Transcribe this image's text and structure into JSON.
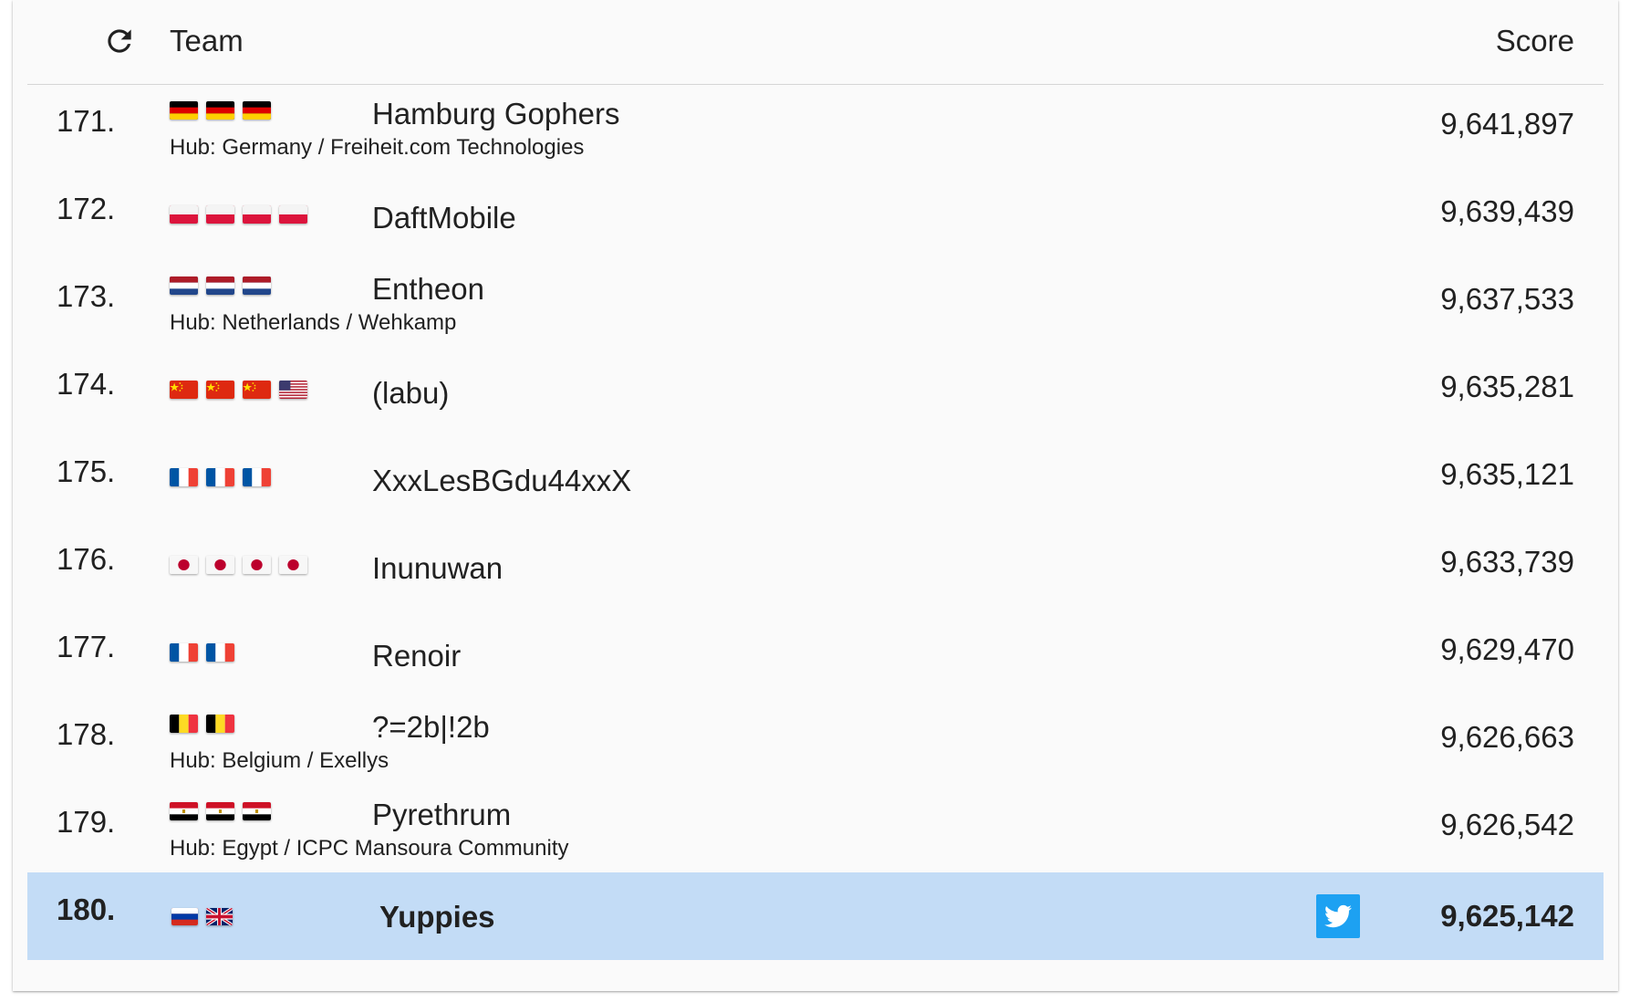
{
  "header": {
    "team_label": "Team",
    "score_label": "Score",
    "refresh_icon": "refresh-icon"
  },
  "rows": [
    {
      "rank": "171.",
      "flags": [
        "de",
        "de",
        "de"
      ],
      "name": "Hamburg Gophers",
      "hub": "Hub: Germany / Freiheit.com Technologies",
      "score": "9,641,897"
    },
    {
      "rank": "172.",
      "flags": [
        "pl",
        "pl",
        "pl",
        "pl"
      ],
      "name": "DaftMobile",
      "hub": "",
      "score": "9,639,439"
    },
    {
      "rank": "173.",
      "flags": [
        "nl",
        "nl",
        "nl"
      ],
      "name": "Entheon",
      "hub": "Hub: Netherlands / Wehkamp",
      "score": "9,637,533"
    },
    {
      "rank": "174.",
      "flags": [
        "cn",
        "cn",
        "cn",
        "us"
      ],
      "name": "(labu)",
      "hub": "",
      "score": "9,635,281"
    },
    {
      "rank": "175.",
      "flags": [
        "fr",
        "fr",
        "fr"
      ],
      "name": "XxxLesBGdu44xxX",
      "hub": "",
      "score": "9,635,121"
    },
    {
      "rank": "176.",
      "flags": [
        "jp",
        "jp",
        "jp",
        "jp"
      ],
      "name": "Inunuwan",
      "hub": "",
      "score": "9,633,739"
    },
    {
      "rank": "177.",
      "flags": [
        "fr",
        "fr"
      ],
      "name": "Renoir",
      "hub": "",
      "score": "9,629,470"
    },
    {
      "rank": "178.",
      "flags": [
        "be",
        "be"
      ],
      "name": "?=2b|!2b",
      "hub": "Hub: Belgium / Exellys",
      "score": "9,626,663"
    },
    {
      "rank": "179.",
      "flags": [
        "eg",
        "eg",
        "eg"
      ],
      "name": "Pyrethrum",
      "hub": "Hub: Egypt / ICPC Mansoura Community",
      "score": "9,626,542"
    },
    {
      "rank": "180.",
      "flags": [
        "ru",
        "gb"
      ],
      "name": "Yuppies",
      "hub": "",
      "score": "9,625,142",
      "highlighted": true,
      "twitter": "twitter-icon"
    }
  ],
  "colors": {
    "highlight_row": "#c3dcf6",
    "twitter_blue": "#1da1f2"
  }
}
